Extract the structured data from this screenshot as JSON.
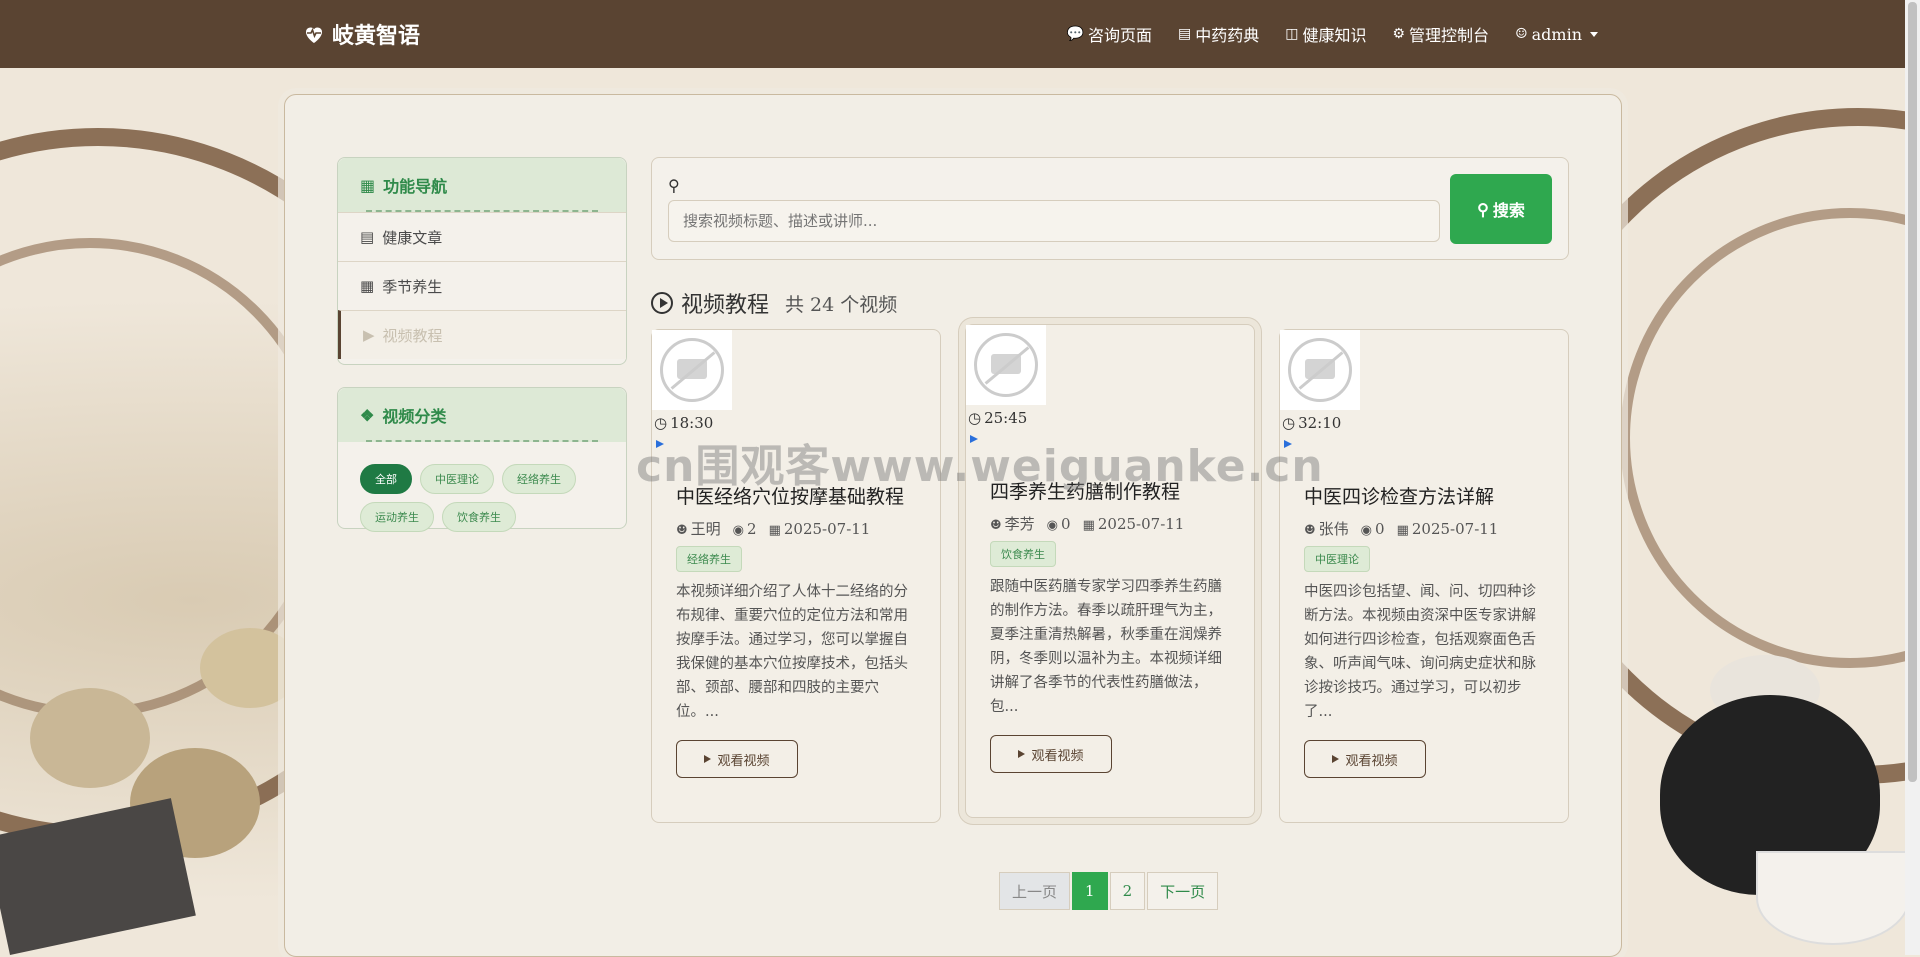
{
  "navbar": {
    "brand": "岐黄智语",
    "links": [
      {
        "label": "咨询页面",
        "icon": "chat-icon"
      },
      {
        "label": "中药药典",
        "icon": "book-icon"
      },
      {
        "label": "健康知识",
        "icon": "open-book-icon"
      },
      {
        "label": "管理控制台",
        "icon": "gear-icon"
      },
      {
        "label": "admin",
        "icon": "user-circle-icon"
      }
    ]
  },
  "sidebar": {
    "nav_title": "功能导航",
    "nav_items": [
      {
        "label": "健康文章",
        "icon": "article-icon"
      },
      {
        "label": "季节养生",
        "icon": "calendar-icon"
      },
      {
        "label": "视频教程",
        "icon": "play-icon"
      }
    ],
    "category_title": "视频分类",
    "categories": [
      "全部",
      "中医理论",
      "经络养生",
      "运动养生",
      "饮食养生"
    ]
  },
  "search": {
    "placeholder": "搜索视频标题、描述或讲师...",
    "button_label": "搜索"
  },
  "section": {
    "title": "视频教程",
    "count_text": "共 24 个视频"
  },
  "videos": [
    {
      "duration": "18:30",
      "title": "中医经络穴位按摩基础教程",
      "author": "王明",
      "views": "2",
      "date": "2025-07-11",
      "category": "经络养生",
      "description": "本视频详细介绍了人体十二经络的分布规律、重要穴位的定位方法和常用按摩手法。通过学习，您可以掌握自我保健的基本穴位按摩技术，包括头部、颈部、腰部和四肢的主要穴位。...",
      "button": "观看视频"
    },
    {
      "duration": "25:45",
      "title": "四季养生药膳制作教程",
      "author": "李芳",
      "views": "0",
      "date": "2025-07-11",
      "category": "饮食养生",
      "description": "跟随中医药膳专家学习四季养生药膳的制作方法。春季以疏肝理气为主，夏季注重清热解暑，秋季重在润燥养阴，冬季则以温补为主。本视频详细讲解了各季节的代表性药膳做法，包...",
      "button": "观看视频"
    },
    {
      "duration": "32:10",
      "title": "中医四诊检查方法详解",
      "author": "张伟",
      "views": "0",
      "date": "2025-07-11",
      "category": "中医理论",
      "description": "中医四诊包括望、闻、问、切四种诊断方法。本视频由资深中医专家讲解如何进行四诊检查，包括观察面色舌象、听声闻气味、询问病史症状和脉诊按诊技巧。通过学习，可以初步了...",
      "button": "观看视频"
    }
  ],
  "pagination": {
    "prev": "上一页",
    "pages": [
      "1",
      "2"
    ],
    "current": "1",
    "next": "下一页"
  },
  "watermark": "cn围观客www.weiguanke.cn",
  "colors": {
    "navbar": "#5a4432",
    "accent_green": "#2fa84f",
    "tag_active": "#1f7a44"
  }
}
